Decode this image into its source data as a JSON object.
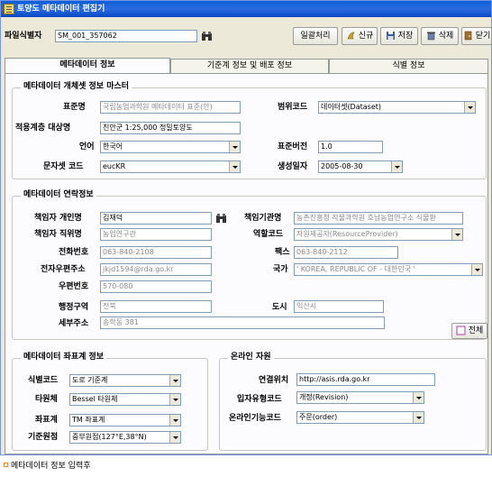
{
  "window": {
    "title": "토양도 메타데이터 편집기"
  },
  "header": {
    "file_id_label": "파일식별자",
    "file_id_value": "SM_001_357062",
    "buttons": {
      "batch": "일괄처리",
      "new": "신규",
      "save": "저장",
      "delete": "삭제",
      "close": "닫기"
    }
  },
  "tabs": [
    {
      "label": "메타데이터 정보"
    },
    {
      "label": "기준계 정보 및 배포 정보"
    },
    {
      "label": "식별 정보"
    }
  ],
  "meta_master": {
    "legend": "메타데이터 개체셋 정보 마스터",
    "standard_name_label": "표준명",
    "standard_name_value": "국립농업과학원 메타데이터 표준(안)",
    "scope_code_label": "범위코드",
    "scope_code_value": "데이터셋(Dataset)",
    "apply_level_label": "적용계층 대상명",
    "apply_level_value": "진안군 1:25,000 정밀토양도",
    "language_label": "언어",
    "language_value": "한국어",
    "standard_version_label": "표준버전",
    "standard_version_value": "1.0",
    "charset_label": "문자셋 코드",
    "charset_value": "eucKR",
    "created_date_label": "생성일자",
    "created_date_value": "2005-08-30"
  },
  "contact": {
    "legend": "메타데이터 연락정보",
    "person_label": "책임자 개인명",
    "person_value": "김재덕",
    "org_label": "책임기관명",
    "org_value": "농촌진흥청 작물과학원 호남농업연구소 식물환",
    "position_label": "책임자 직위명",
    "position_value": "농업연구관",
    "role_label": "역할코드",
    "role_value": "자원제공자(ResourceProvider)",
    "phone_label": "전화번호",
    "phone_value": "063-840-2108",
    "fax_label": "팩스",
    "fax_value": "063-840-2112",
    "email_label": "전자우편주소",
    "email_value": "jkjd1594@rda.go.kr",
    "country_label": "국가",
    "country_value": "' KOREA, REPUBLIC OF - 대한민국 '",
    "zip_label": "우편번호",
    "zip_value": "570-080",
    "province_label": "행정구역",
    "province_value": "전북",
    "city_label": "도시",
    "city_value": "익산시",
    "address_label": "세부주소",
    "address_value": "송학동 381",
    "all_button": "전체"
  },
  "coordinate": {
    "legend": "메타데이터 좌표계 정보",
    "id_code_label": "식별코드",
    "id_code_value": "도로 기준계",
    "ellipsoid_label": "타원체",
    "ellipsoid_value": "Bessel 타원체",
    "coord_system_label": "좌표계",
    "coord_system_value": "TM 좌표계",
    "origin_label": "기준원점",
    "origin_value": "중부원점(127°E,38°N)"
  },
  "online": {
    "legend": "온라인 자원",
    "link_label": "연결위치",
    "link_value": "http://asis.rda.go.kr",
    "protocol_label": "입자유형코드",
    "protocol_value": "개정(Revision)",
    "function_label": "온라인기능코드",
    "function_value": "주문(order)"
  },
  "footer_caption": "메타데이터 정보 입력후"
}
